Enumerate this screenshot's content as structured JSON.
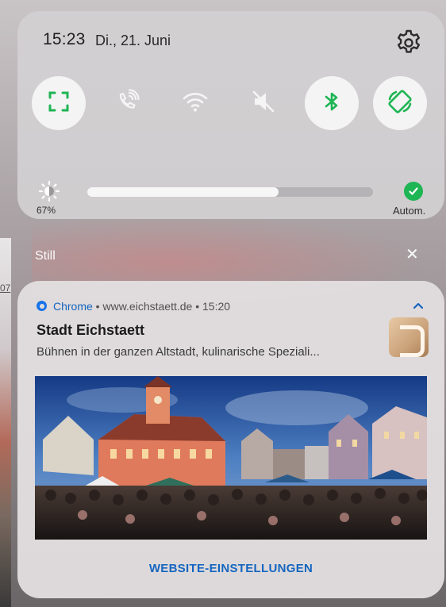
{
  "background": {
    "partial_link": "07"
  },
  "quick_settings": {
    "time": "15:23",
    "date": "Di., 21. Juni",
    "tiles": [
      {
        "name": "screenshot",
        "active": true
      },
      {
        "name": "wifi-calling",
        "active": false
      },
      {
        "name": "wifi",
        "active": false
      },
      {
        "name": "mute",
        "active": false
      },
      {
        "name": "bluetooth",
        "active": true
      },
      {
        "name": "auto-rotate",
        "active": true
      }
    ],
    "brightness_percent": "67%",
    "brightness_level": 0.67,
    "auto_label": "Autom."
  },
  "section": {
    "title": "Still",
    "close_symbol": "✕"
  },
  "notification": {
    "app_name": "Chrome",
    "source": " • www.eichstaett.de • 15:20",
    "title": "Stadt Eichstaett",
    "text": "Bühnen in der ganzen Altstadt, kulinarische Speziali...",
    "action_label": "WEBSITE-EINSTELLUNGEN"
  },
  "colors": {
    "accent_green": "#1eb554",
    "link_blue": "#1565c0"
  }
}
